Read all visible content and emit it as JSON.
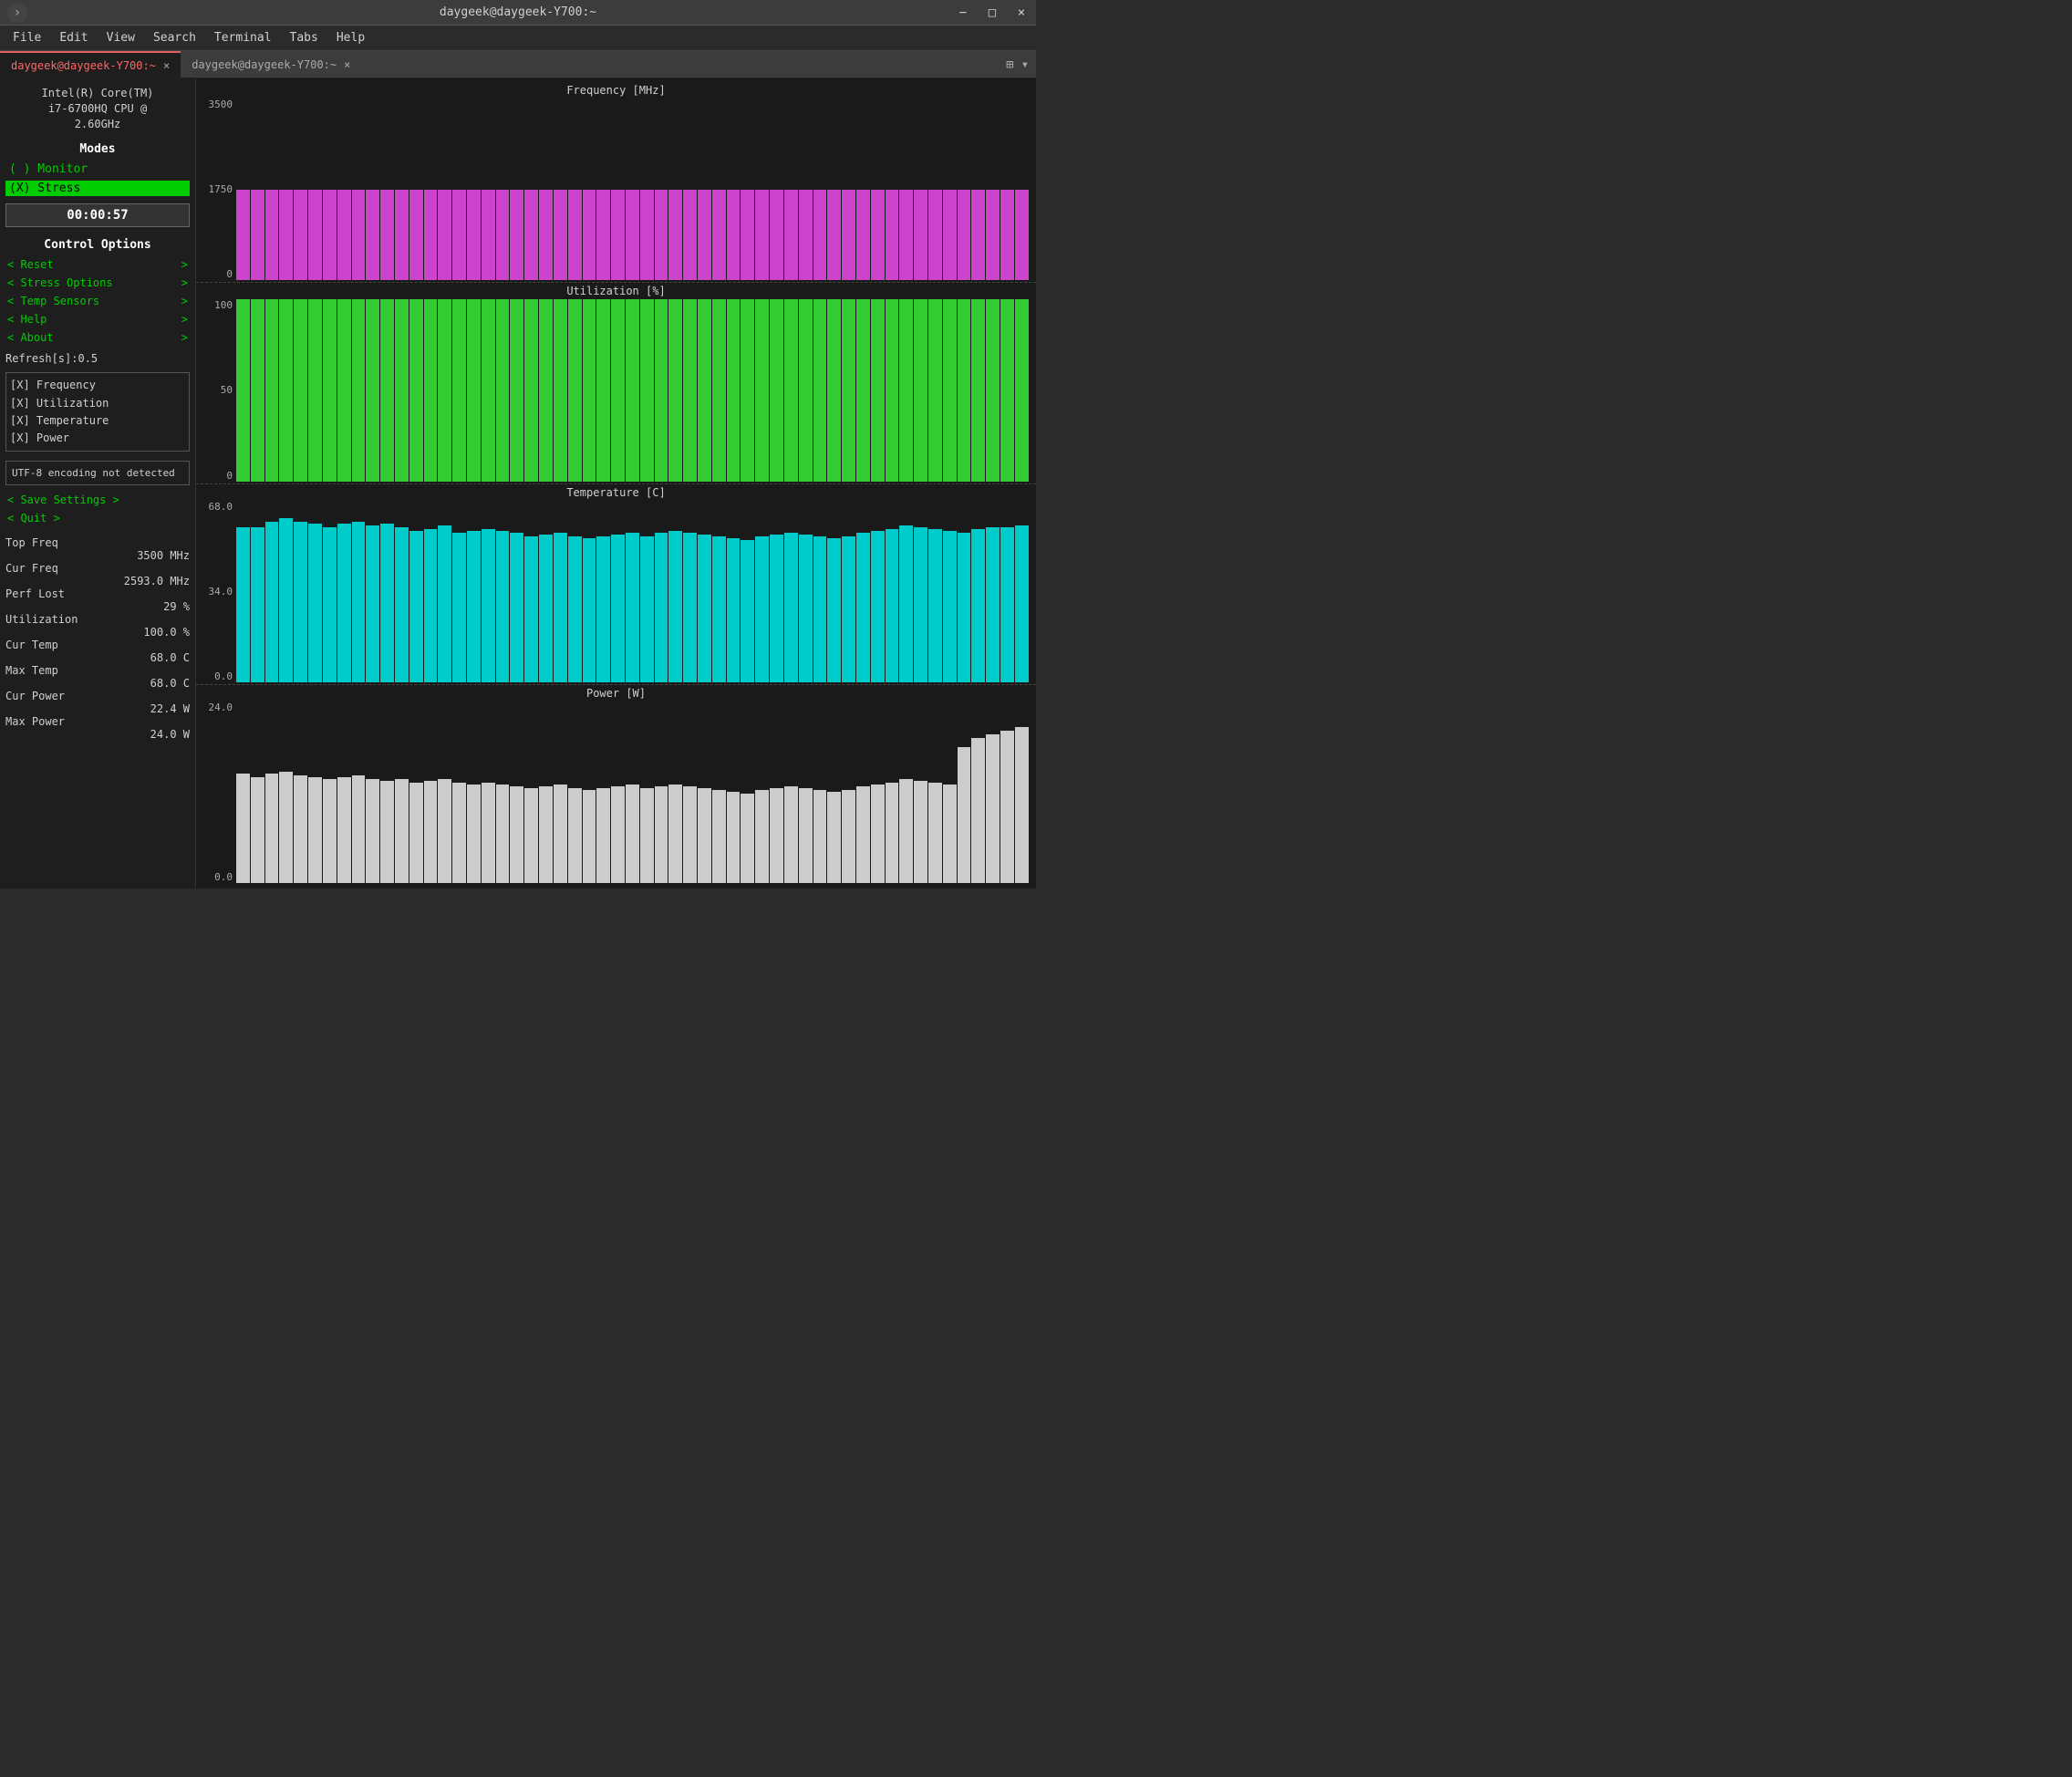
{
  "window": {
    "title": "daygeek@daygeek-Y700:~",
    "controls": [
      "−",
      "□",
      "×"
    ]
  },
  "menubar": {
    "items": [
      "File",
      "Edit",
      "View",
      "Search",
      "Terminal",
      "Tabs",
      "Help"
    ]
  },
  "tabs": [
    {
      "label": "daygeek@daygeek-Y700:~",
      "active": true
    },
    {
      "label": "daygeek@daygeek-Y700:~",
      "active": false
    }
  ],
  "left_panel": {
    "cpu_info": "Intel(R) Core(TM)\ni7-6700HQ CPU @\n2.60GHz",
    "modes_title": "Modes",
    "monitor_label": "( ) Monitor",
    "stress_label": "(X) Stress",
    "timer": "00:00:57",
    "control_options_title": "Control Options",
    "controls": [
      {
        "label": "< Reset",
        "arrow": ">"
      },
      {
        "label": "< Stress Options",
        "arrow": ">"
      },
      {
        "label": "< Temp Sensors",
        "arrow": ">"
      },
      {
        "label": "< Help",
        "arrow": ">"
      },
      {
        "label": "< About",
        "arrow": ">"
      }
    ],
    "refresh_label": "Refresh[s]:0.5",
    "checkboxes": [
      "[X] Frequency",
      "[X] Utilization",
      "[X] Temperature",
      "[X] Power"
    ],
    "encoding_notice": "UTF-8 encoding not detected",
    "save_settings": "< Save Settings >",
    "quit": "< Quit >",
    "stats": {
      "top_freq_label": "Top Freq",
      "top_freq_value": "3500 MHz",
      "cur_freq_label": "Cur Freq",
      "cur_freq_value": "2593.0 MHz",
      "perf_lost_label": "Perf Lost",
      "perf_lost_value": "29 %",
      "utilization_label": "Utilization",
      "utilization_value": "100.0 %",
      "cur_temp_label": "Cur Temp",
      "cur_temp_value": "68.0 C",
      "max_temp_label": "Max Temp",
      "max_temp_value": "68.0 C",
      "cur_power_label": "Cur Power",
      "cur_power_value": "22.4 W",
      "max_power_label": "Max Power",
      "max_power_value": "24.0 W"
    }
  },
  "charts": {
    "frequency": {
      "title": "Frequency [MHz]",
      "color": "#cc44cc",
      "y_max": "3500",
      "y_mid": "1750",
      "y_min": "0",
      "bar_count": 55,
      "bar_height_pct": 55
    },
    "utilization": {
      "title": "Utilization [%]",
      "color": "#33cc33",
      "y_max": "100",
      "y_mid": "50",
      "y_min": "0",
      "bar_count": 55,
      "bar_height_pct": 100
    },
    "temperature": {
      "title": "Temperature [C]",
      "color": "#00cccc",
      "y_max": "68.0",
      "y_mid": "34.0",
      "y_min": "0.0",
      "bar_count": 55,
      "bar_heights": [
        85,
        85,
        88,
        90,
        88,
        87,
        85,
        87,
        88,
        86,
        87,
        85,
        83,
        84,
        86,
        82,
        83,
        84,
        83,
        82,
        80,
        81,
        82,
        80,
        79,
        80,
        81,
        82,
        80,
        82,
        83,
        82,
        81,
        80,
        79,
        78,
        80,
        81,
        82,
        81,
        80,
        79,
        80,
        82,
        83,
        84,
        86,
        85,
        84,
        83,
        82,
        84,
        85,
        85,
        86
      ]
    },
    "power": {
      "title": "Power [W]",
      "color": "#cccccc",
      "y_max": "24.0",
      "y_mid": "",
      "y_min": "0.0",
      "bar_count": 55,
      "bar_heights": [
        60,
        58,
        60,
        61,
        59,
        58,
        57,
        58,
        59,
        57,
        56,
        57,
        55,
        56,
        57,
        55,
        54,
        55,
        54,
        53,
        52,
        53,
        54,
        52,
        51,
        52,
        53,
        54,
        52,
        53,
        54,
        53,
        52,
        51,
        50,
        49,
        51,
        52,
        53,
        52,
        51,
        50,
        51,
        53,
        54,
        55,
        57,
        56,
        55,
        54,
        75,
        80,
        82,
        84,
        86
      ]
    }
  }
}
